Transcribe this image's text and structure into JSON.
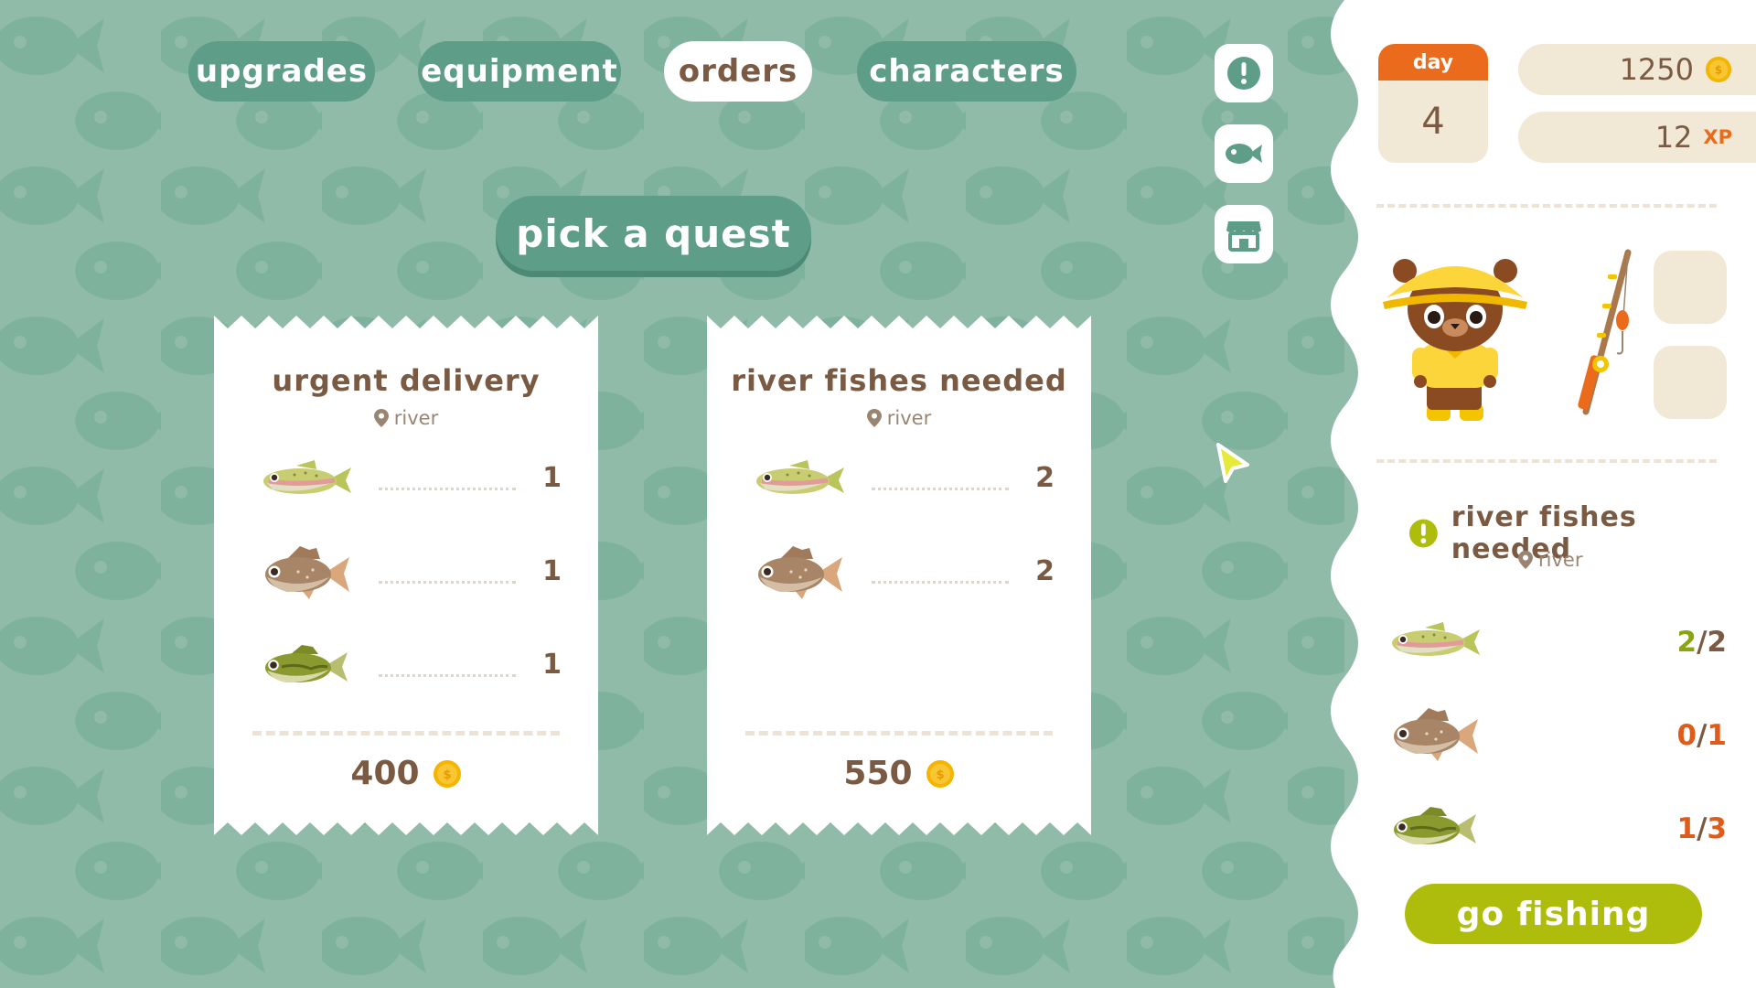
{
  "nav": {
    "tabs": [
      {
        "label": "upgrades",
        "active": false
      },
      {
        "label": "equipment",
        "active": false
      },
      {
        "label": "orders",
        "active": true
      },
      {
        "label": "characters",
        "active": false
      }
    ]
  },
  "side_buttons": [
    "alert-icon",
    "fish-icon",
    "shop-icon"
  ],
  "header": {
    "pick_quest": "pick a quest"
  },
  "quests": [
    {
      "title": "urgent delivery",
      "location": "river",
      "items": [
        {
          "fish": "trout",
          "qty": "1"
        },
        {
          "fish": "perch",
          "qty": "1"
        },
        {
          "fish": "bass",
          "qty": "1"
        }
      ],
      "reward": "400"
    },
    {
      "title": "river fishes needed",
      "location": "river",
      "items": [
        {
          "fish": "trout",
          "qty": "2"
        },
        {
          "fish": "perch",
          "qty": "2"
        }
      ],
      "reward": "550"
    }
  ],
  "status": {
    "day_label": "day",
    "day_value": "4",
    "coins": "1250",
    "xp": "12",
    "xp_label": "XP"
  },
  "active_quest": {
    "title": "river fishes needed",
    "location": "river",
    "progress": [
      {
        "fish": "trout",
        "current": "2",
        "total": "2",
        "color": "#8aa512"
      },
      {
        "fish": "perch",
        "current": "0",
        "total": "1",
        "color": "#e05a1a"
      },
      {
        "fish": "bass",
        "current": "1",
        "total": "3",
        "color": "#e05a1a"
      }
    ]
  },
  "actions": {
    "go_fishing": "go fishing"
  },
  "colors": {
    "background": "#8fbba8",
    "tab": "#5e9d87",
    "text_brown": "#7a5a42",
    "accent_orange": "#ea6b1c",
    "go_button": "#aebd0b",
    "coin": "#f4b400"
  }
}
